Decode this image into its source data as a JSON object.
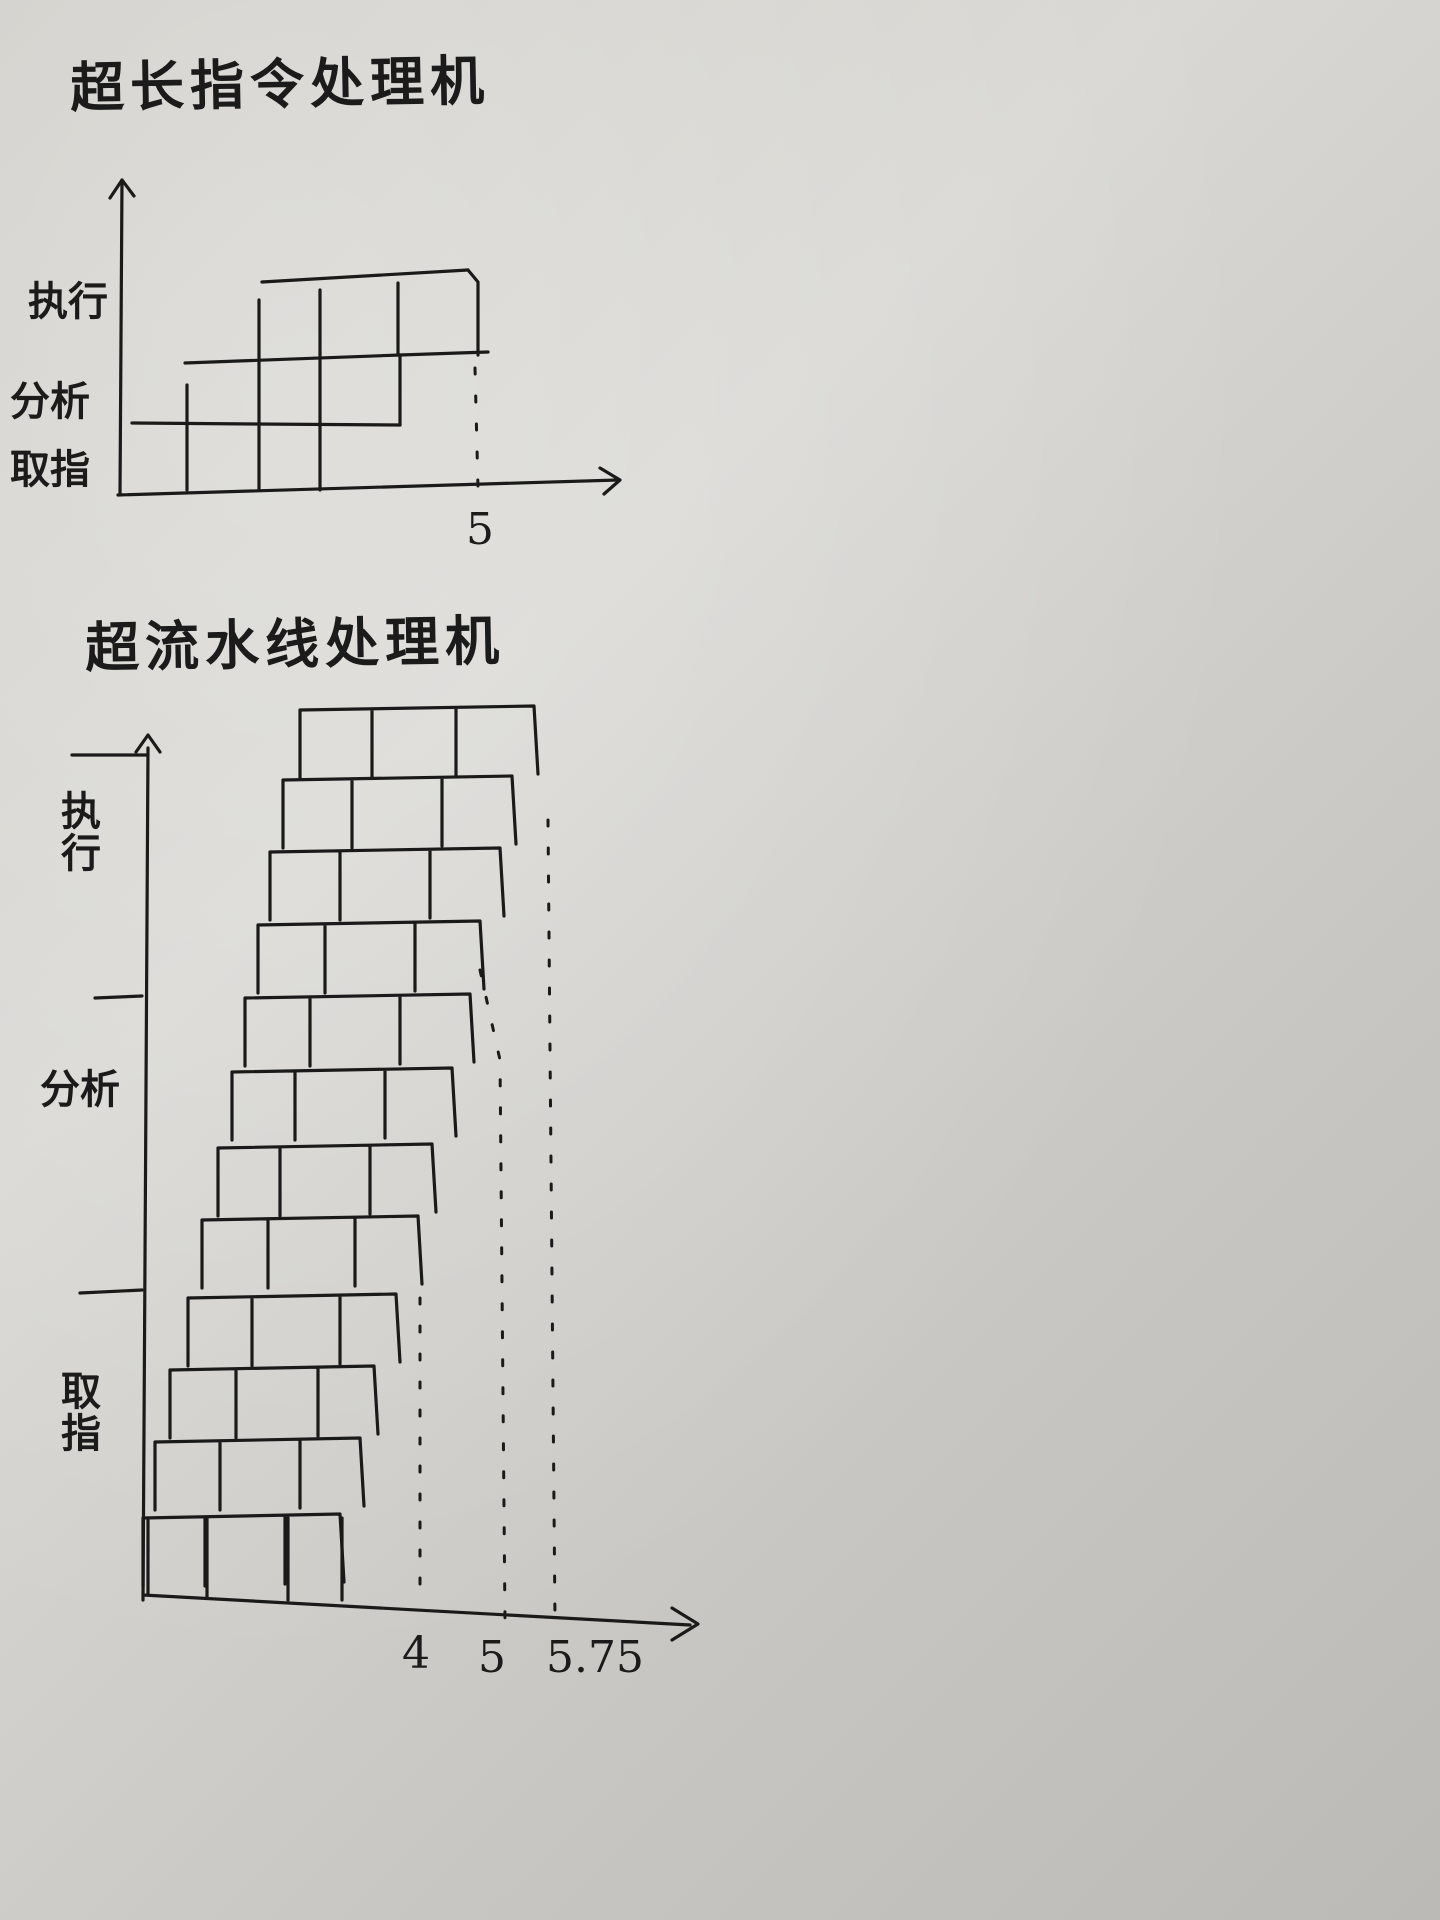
{
  "diagram1": {
    "title": "超长指令处理机",
    "y_labels": {
      "exec": "执行",
      "analyze": "分析",
      "fetch": "取指"
    },
    "x_tick": "5"
  },
  "diagram2": {
    "title": "超流水线处理机",
    "y_labels": {
      "exec": "执行",
      "analyze": "分析",
      "fetch": "取指"
    },
    "x_ticks": [
      "4",
      "5",
      "5.75"
    ]
  }
}
